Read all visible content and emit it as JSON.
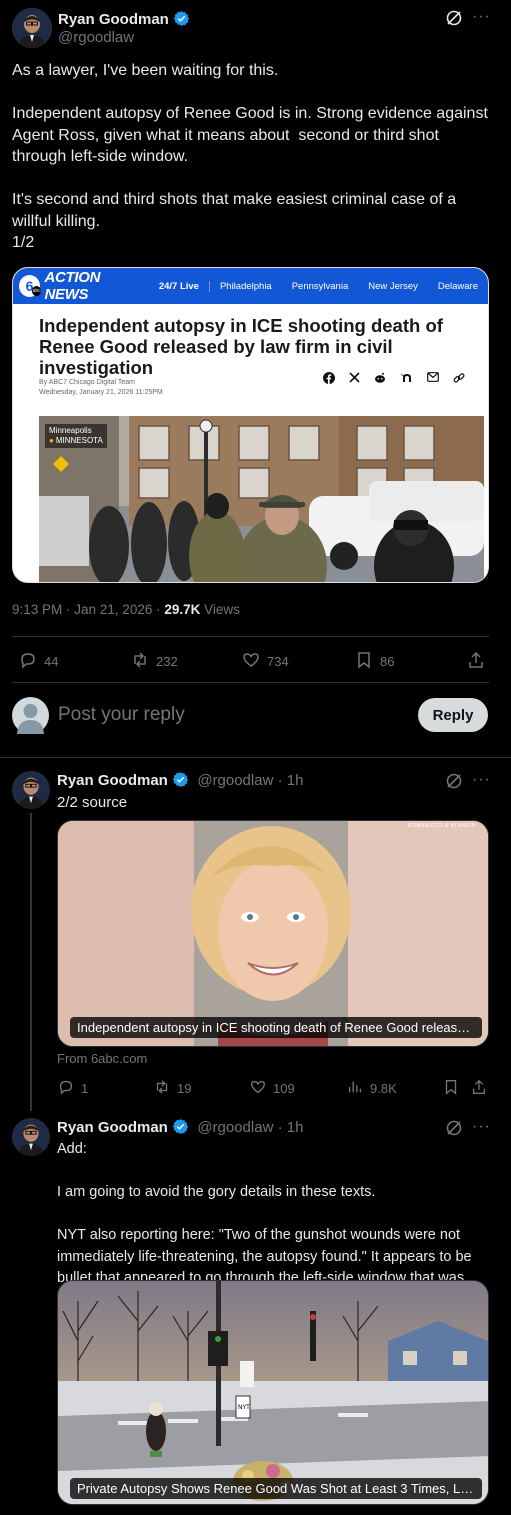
{
  "main_tweet": {
    "author_name": "Ryan Goodman",
    "handle": "@rgoodlaw",
    "text": "As a lawyer, I've been waiting for this.\n\nIndependent autopsy of Renee Good is in. Strong evidence against Agent Ross, given what it means about  second or third shot through left-side window.\n\nIt's second and third shots that make easiest criminal case of a willful killing.\n1/2",
    "timestamp": "9:13 PM · Jan 21, 2026 · ",
    "views_count": "29.7K",
    "views_label": " Views",
    "replies": "44",
    "reposts": "232",
    "likes": "734",
    "bookmarks": "86",
    "article": {
      "brand": "ACTION NEWS",
      "logo_badge": "abc",
      "nav_items": [
        "24/7 Live",
        "Philadelphia",
        "Pennsylvania",
        "New Jersey",
        "Delaware"
      ],
      "headline": "Independent autopsy in ICE shooting death of Renee Good released by law firm in civil investigation",
      "byline": "By ABC7 Chicago Digital Team",
      "date": "Wednesday, January 21, 2026 11:25PM",
      "location_city": "Minneapolis",
      "location_state": "MINNESOTA",
      "share_icons": [
        "facebook-icon",
        "x-icon",
        "reddit-icon",
        "nextdoor-icon",
        "email-icon",
        "link-icon"
      ]
    }
  },
  "reply_box": {
    "placeholder": "Post your reply",
    "button": "Reply"
  },
  "thread_tweet_2": {
    "author_name": "Ryan Goodman",
    "handle_time": "@rgoodlaw · 1h",
    "text": "2/2 source",
    "card_caption": "Independent autopsy in ICE shooting death of Renee Good released...",
    "card_watermark": "ROMANUCCI & BLANDIN",
    "card_source": "From 6abc.com",
    "replies": "1",
    "reposts": "19",
    "likes": "109",
    "views": "9.8K"
  },
  "thread_tweet_3": {
    "author_name": "Ryan Goodman",
    "handle_time": "@rgoodlaw · 1h",
    "text": "Add:\n\nI am going to avoid the gory details in these texts.\n\nNYT also reporting here: \"Two of the gunshot wounds were not immediately life-threatening, the autopsy found.\" It appears to be bullet that appeared to go through the left-side window that was.",
    "card_caption": "Private Autopsy Shows Renee Good Was Shot at Least 3 Times, Law...",
    "sign_text": "NYT"
  },
  "colors": {
    "background": "#000000",
    "text": "#e7e9ea",
    "muted": "#71767b",
    "divider": "#2f3336",
    "verified": "#1d9bf0",
    "abc_blue": "#1258d6"
  }
}
